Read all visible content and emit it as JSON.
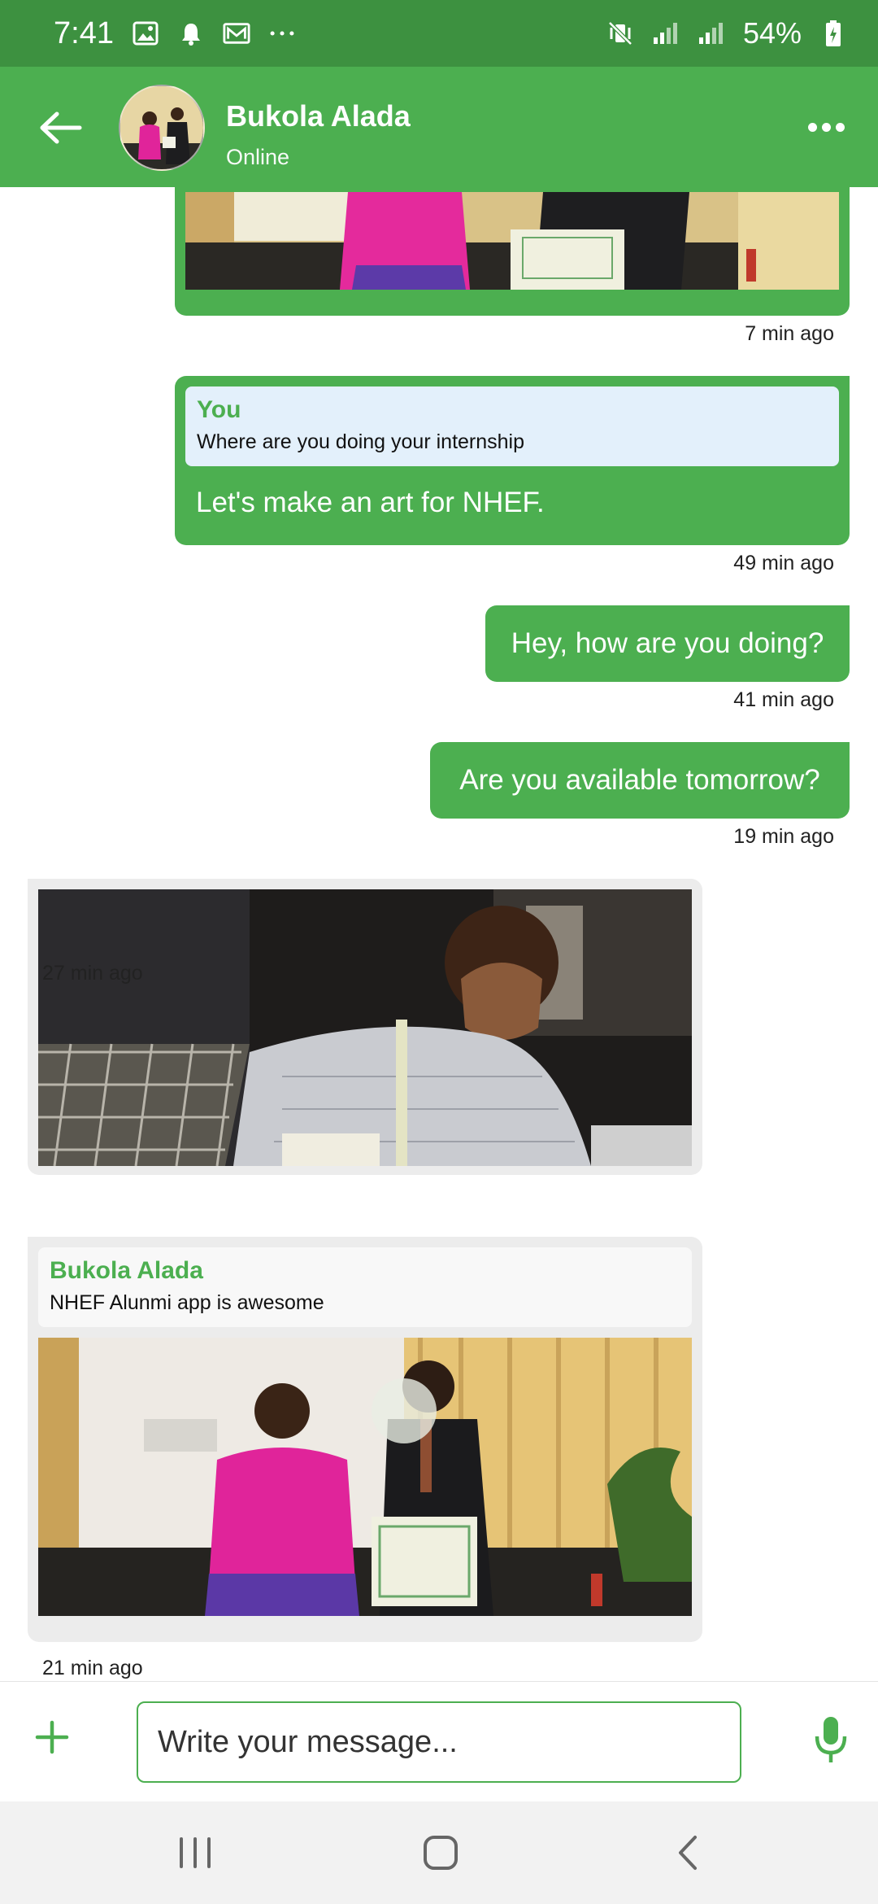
{
  "status_bar": {
    "time": "7:41",
    "battery": "54%"
  },
  "header": {
    "contact_name": "Bukola Alada",
    "contact_status": "Online"
  },
  "messages": [
    {
      "type": "image-out",
      "time": "7 min ago"
    },
    {
      "type": "reply-out",
      "quote_title": "You",
      "quote_text": "Where are you doing your internship",
      "text": "Let's make an art for NHEF.",
      "time": "49 min ago"
    },
    {
      "type": "text-out",
      "text": "Hey, how are you doing?",
      "time": "41 min ago"
    },
    {
      "type": "text-out",
      "text": "Are you available tomorrow?",
      "time": "19 min ago"
    },
    {
      "type": "image-in",
      "time": "27 min ago"
    },
    {
      "type": "reply-image-in",
      "quote_title": "Bukola Alada",
      "quote_text": "NHEF Alunmi app is awesome",
      "time": "21 min ago"
    }
  ],
  "composer": {
    "placeholder": "Write your message..."
  },
  "colors": {
    "status_bar": "#3d9140",
    "header": "#4caf50",
    "bubble_out": "#4caf50",
    "bubble_in": "#ececec"
  }
}
